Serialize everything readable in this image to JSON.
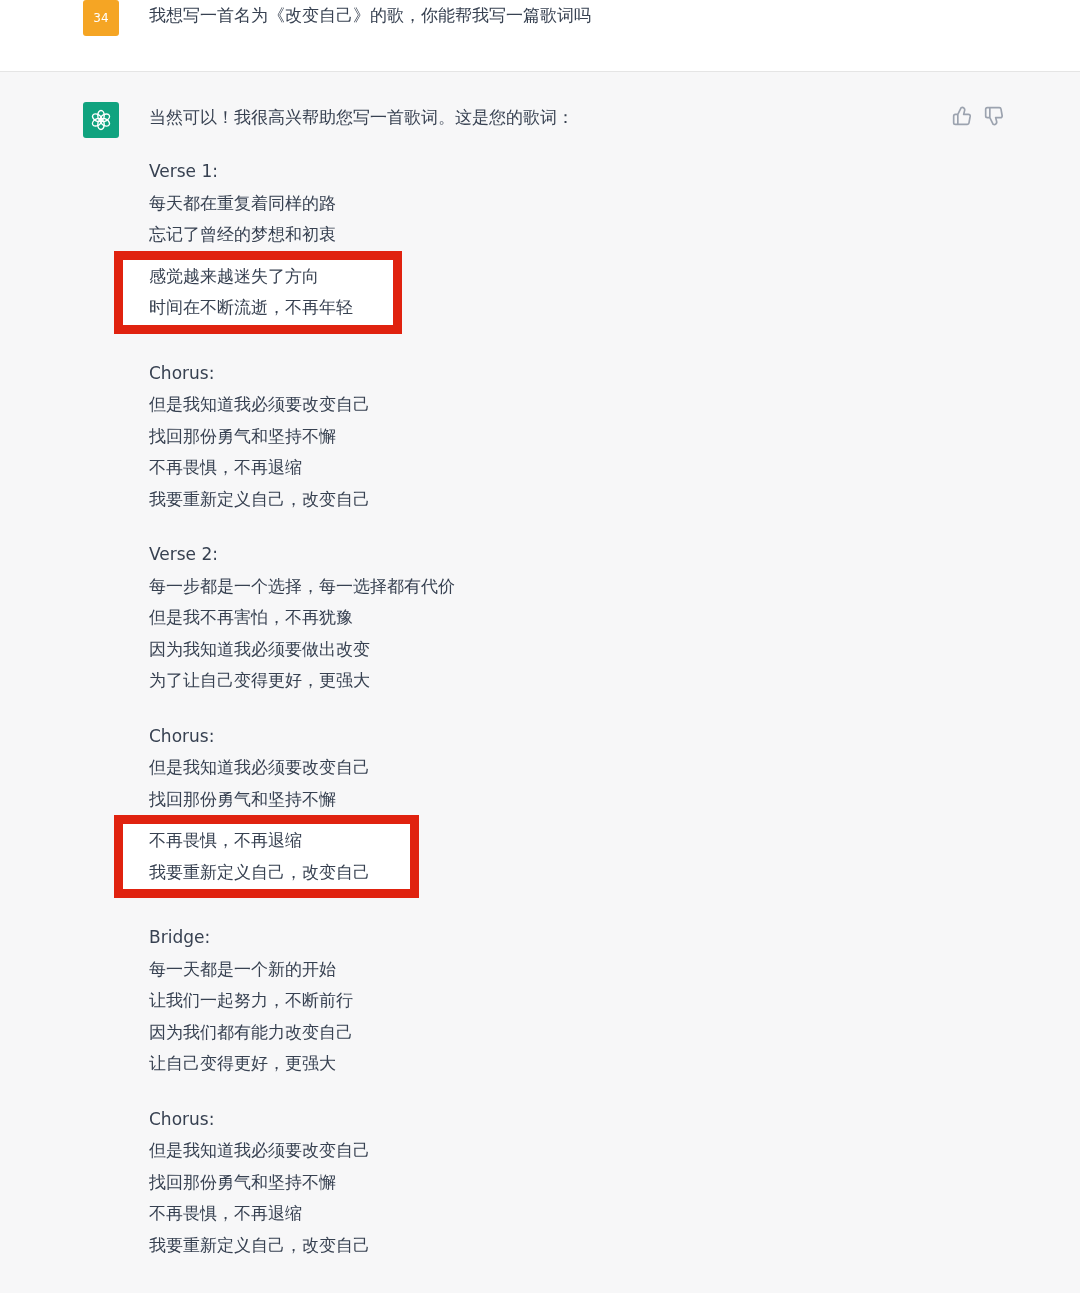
{
  "user_message": {
    "avatar": "34",
    "text": "我想写一首名为《改变自己》的歌，你能帮我写一篇歌词吗"
  },
  "assistant_message": {
    "intro": "当然可以！我很高兴帮助您写一首歌词。这是您的歌词：",
    "sections": [
      {
        "label": "Verse 1:",
        "lines": [
          {
            "text": "每天都在重复着同样的路",
            "highlighted": false
          },
          {
            "text": "忘记了曾经的梦想和初衷",
            "highlighted": false
          },
          {
            "text": "感觉越来越迷失了方向",
            "highlighted": true
          },
          {
            "text": "时间在不断流逝，不再年轻",
            "highlighted": true
          }
        ]
      },
      {
        "label": "Chorus:",
        "lines": [
          {
            "text": "但是我知道我必须要改变自己",
            "highlighted": false
          },
          {
            "text": "找回那份勇气和坚持不懈",
            "highlighted": false
          },
          {
            "text": "不再畏惧，不再退缩",
            "highlighted": false
          },
          {
            "text": "我要重新定义自己，改变自己",
            "highlighted": false
          }
        ]
      },
      {
        "label": "Verse 2:",
        "lines": [
          {
            "text": "每一步都是一个选择，每一选择都有代价",
            "highlighted": false
          },
          {
            "text": "但是我不再害怕，不再犹豫",
            "highlighted": false
          },
          {
            "text": "因为我知道我必须要做出改变",
            "highlighted": false
          },
          {
            "text": "为了让自己变得更好，更强大",
            "highlighted": false
          }
        ]
      },
      {
        "label": "Chorus:",
        "lines": [
          {
            "text": "但是我知道我必须要改变自己",
            "highlighted": false
          },
          {
            "text": "找回那份勇气和坚持不懈",
            "highlighted": false
          },
          {
            "text": "不再畏惧，不再退缩",
            "highlighted": true
          },
          {
            "text": "我要重新定义自己，改变自己",
            "highlighted": true
          }
        ]
      },
      {
        "label": "Bridge:",
        "lines": [
          {
            "text": "每一天都是一个新的开始",
            "highlighted": false
          },
          {
            "text": "让我们一起努力，不断前行",
            "highlighted": false
          },
          {
            "text": "因为我们都有能力改变自己",
            "highlighted": false
          },
          {
            "text": "让自己变得更好，更强大",
            "highlighted": false
          }
        ]
      },
      {
        "label": "Chorus:",
        "lines": [
          {
            "text": "但是我知道我必须要改变自己",
            "highlighted": false
          },
          {
            "text": "找回那份勇气和坚持不懈",
            "highlighted": false
          },
          {
            "text": "不再畏惧，不再退缩",
            "highlighted": false
          },
          {
            "text": "我要重新定义自己，改变自己",
            "highlighted": false
          }
        ]
      }
    ]
  }
}
